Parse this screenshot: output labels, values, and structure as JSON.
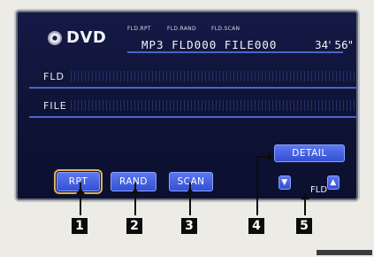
{
  "source": {
    "label": "DVD",
    "icon": "disc-icon"
  },
  "status": {
    "mode_captions": [
      "FLD.RPT",
      "FLD.RAND",
      "FLD.SCAN"
    ],
    "track_info": "MP3 FLD000 FILE000",
    "elapsed_time": "34' 56\""
  },
  "bars": {
    "folder_label": "FLD",
    "file_label": "FILE"
  },
  "buttons": {
    "rpt": "RPT",
    "rand": "RAND",
    "scan": "SCAN",
    "detail": "DETAIL",
    "folder_down_icon": "triangle-down-icon",
    "folder_up_icon": "triangle-up-icon",
    "folder_label": "FLD"
  },
  "callouts": [
    "1",
    "2",
    "3",
    "4",
    "5"
  ],
  "colors": {
    "screen_bg": "#0e1336",
    "button": "#3450d4",
    "rule": "#4d64c8",
    "active_outline": "#ddb15a"
  }
}
